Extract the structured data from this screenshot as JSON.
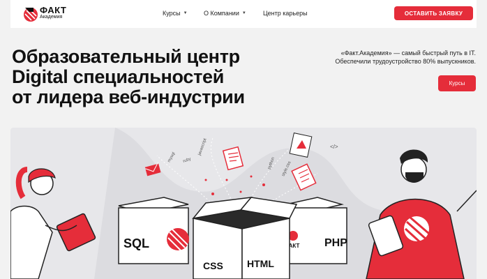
{
  "header": {
    "logo_name": "ФАКТ",
    "logo_sub": "Академия",
    "nav": [
      {
        "label": "Курсы",
        "has_dropdown": true
      },
      {
        "label": "О Компании",
        "has_dropdown": true
      },
      {
        "label": "Центр карьеры",
        "has_dropdown": false
      }
    ],
    "cta_label": "ОСТАВИТЬ ЗАЯВКУ"
  },
  "hero": {
    "title_lines": [
      "Образовательный центр",
      "Digital специальностей",
      "от лидера веб-индустрии"
    ],
    "description": "«Факт.Академия» — самый быстрый путь в IT. Обеспечили трудоустройство 80% выпускников.",
    "button_label": "Курсы"
  },
  "illustration": {
    "box_labels": [
      "SQL",
      "CSS",
      "HTML",
      "PHP"
    ],
    "box_logo": "ФАКТ",
    "floating_words": [
      "mysql",
      "javascript",
      "ruby",
      "python",
      "style.css",
      "</>"
    ]
  },
  "colors": {
    "accent": "#e52d3a",
    "banner_bg": "#e7e7ea",
    "page_bg": "#f2f2f2"
  },
  "icons": [
    "fakt-logo-icon",
    "chevron-down-icon",
    "mail-icon",
    "document-icon",
    "chart-card-icon"
  ]
}
